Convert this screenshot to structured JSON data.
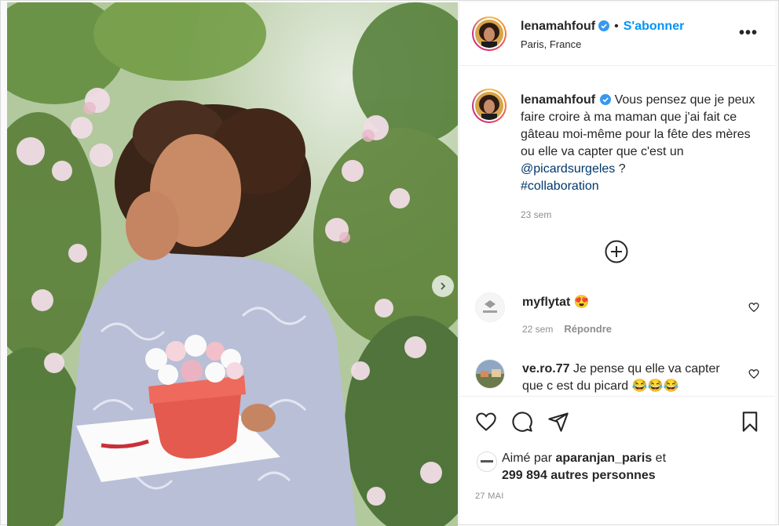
{
  "post": {
    "author": "lenamahfouf",
    "follow_label": "S'abonner",
    "location": "Paris, France",
    "more_label": "•••",
    "caption": {
      "username": "lenamahfouf",
      "text": "Vous pensez que je peux faire croire à ma maman que j'ai fait ce gâteau moi-même pour la fête des mères ou elle va capter que c'est un",
      "mention": "@picardsurgeles",
      "after_mention": " ?",
      "hashtag": "#collaboration",
      "time": "23 sem"
    },
    "comments": [
      {
        "username": "myflytat",
        "text": "😍",
        "time": "22 sem",
        "reply_label": "Répondre"
      },
      {
        "username": "ve.ro.77",
        "text": "Je pense qu elle va capter que c est du picard 😂😂😂"
      }
    ],
    "likes": {
      "prefix": "Aimé par",
      "liker": "aparanjan_paris",
      "and": "et",
      "others": "299 894 autres personnes"
    },
    "date": "27 MAI"
  },
  "colors": {
    "accent": "#0095f6",
    "link": "#00376b",
    "muted": "#8e8e8e",
    "text": "#262626"
  },
  "icons": [
    "verified-icon",
    "more-icon",
    "add-comment-icon",
    "heart-icon",
    "comment-icon",
    "share-icon",
    "save-icon",
    "next-arrow-icon"
  ]
}
